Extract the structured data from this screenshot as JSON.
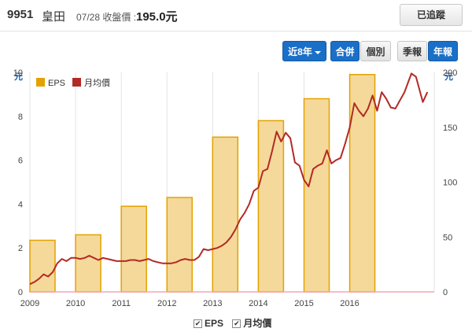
{
  "header": {
    "stock_id": "9951",
    "stock_name": "皇田",
    "date_label": "07/28 收盤價 :",
    "price": "195.0元",
    "track_label": "已追蹤"
  },
  "toolbar": {
    "range_label": "近8年",
    "combined_label": "合併",
    "individual_label": "個別",
    "quarterly_label": "季報",
    "annual_label": "年報"
  },
  "colors": {
    "eps_fill": "#f5d99a",
    "eps_stroke": "#e4a100",
    "price_line": "#b22a25",
    "axis_label": "#1a5fa8"
  },
  "bottom_legend": {
    "eps": "EPS",
    "price": "月均價"
  },
  "chart_data": {
    "type": "bar+line",
    "left_axis_unit": "元",
    "right_axis_unit": "元",
    "left_ylim": [
      0,
      10
    ],
    "left_ticks": [
      0,
      2,
      4,
      6,
      8,
      10
    ],
    "right_ylim": [
      0,
      200
    ],
    "right_ticks": [
      0,
      50,
      100,
      150,
      200
    ],
    "x_ticks": [
      "2009",
      "2010",
      "2011",
      "2012",
      "2013",
      "2014",
      "2015",
      "2016"
    ],
    "legend": [
      "EPS",
      "月均價"
    ],
    "legend_position": "top-left",
    "grid": "vertical",
    "bars": {
      "name": "EPS",
      "x": [
        "2009",
        "2010",
        "2011",
        "2012",
        "2013",
        "2014",
        "2015",
        "2016"
      ],
      "values": [
        2.35,
        2.6,
        3.9,
        4.3,
        7.05,
        7.8,
        8.8,
        9.9
      ]
    },
    "line": {
      "name": "月均價",
      "points": [
        [
          2009.0,
          7
        ],
        [
          2009.1,
          9
        ],
        [
          2009.2,
          12
        ],
        [
          2009.3,
          16
        ],
        [
          2009.4,
          14
        ],
        [
          2009.5,
          18
        ],
        [
          2009.6,
          26
        ],
        [
          2009.7,
          30
        ],
        [
          2009.8,
          28
        ],
        [
          2009.9,
          31
        ],
        [
          2010.0,
          31
        ],
        [
          2010.1,
          30
        ],
        [
          2010.2,
          31
        ],
        [
          2010.3,
          33
        ],
        [
          2010.4,
          31
        ],
        [
          2010.5,
          29
        ],
        [
          2010.6,
          31
        ],
        [
          2010.7,
          30
        ],
        [
          2010.8,
          29
        ],
        [
          2010.9,
          28
        ],
        [
          2011.0,
          28
        ],
        [
          2011.1,
          28
        ],
        [
          2011.2,
          29
        ],
        [
          2011.3,
          29
        ],
        [
          2011.4,
          28
        ],
        [
          2011.5,
          29
        ],
        [
          2011.6,
          30
        ],
        [
          2011.7,
          28
        ],
        [
          2011.8,
          27
        ],
        [
          2011.9,
          26
        ],
        [
          2012.0,
          26
        ],
        [
          2012.1,
          26
        ],
        [
          2012.2,
          27
        ],
        [
          2012.3,
          29
        ],
        [
          2012.4,
          30
        ],
        [
          2012.5,
          29
        ],
        [
          2012.6,
          29
        ],
        [
          2012.7,
          32
        ],
        [
          2012.8,
          39
        ],
        [
          2012.9,
          38
        ],
        [
          2013.0,
          39
        ],
        [
          2013.1,
          40
        ],
        [
          2013.2,
          42
        ],
        [
          2013.3,
          45
        ],
        [
          2013.4,
          50
        ],
        [
          2013.5,
          57
        ],
        [
          2013.6,
          66
        ],
        [
          2013.7,
          72
        ],
        [
          2013.8,
          80
        ],
        [
          2013.9,
          92
        ],
        [
          2014.0,
          95
        ],
        [
          2014.1,
          110
        ],
        [
          2014.2,
          112
        ],
        [
          2014.3,
          128
        ],
        [
          2014.4,
          146
        ],
        [
          2014.5,
          137
        ],
        [
          2014.6,
          145
        ],
        [
          2014.7,
          140
        ],
        [
          2014.8,
          118
        ],
        [
          2014.9,
          115
        ],
        [
          2015.0,
          102
        ],
        [
          2015.1,
          96
        ],
        [
          2015.2,
          112
        ],
        [
          2015.3,
          115
        ],
        [
          2015.4,
          117
        ],
        [
          2015.5,
          129
        ],
        [
          2015.6,
          117
        ],
        [
          2015.7,
          120
        ],
        [
          2015.8,
          122
        ],
        [
          2015.9,
          135
        ],
        [
          2016.0,
          150
        ],
        [
          2016.1,
          172
        ],
        [
          2016.2,
          165
        ],
        [
          2016.3,
          160
        ],
        [
          2016.4,
          167
        ],
        [
          2016.5,
          179
        ],
        [
          2016.6,
          165
        ],
        [
          2016.7,
          182
        ],
        [
          2016.8,
          176
        ],
        [
          2016.9,
          168
        ],
        [
          2017.0,
          167
        ],
        [
          2017.2,
          182
        ],
        [
          2017.35,
          199
        ],
        [
          2017.45,
          196
        ],
        [
          2017.6,
          173
        ],
        [
          2017.7,
          182
        ]
      ]
    }
  }
}
